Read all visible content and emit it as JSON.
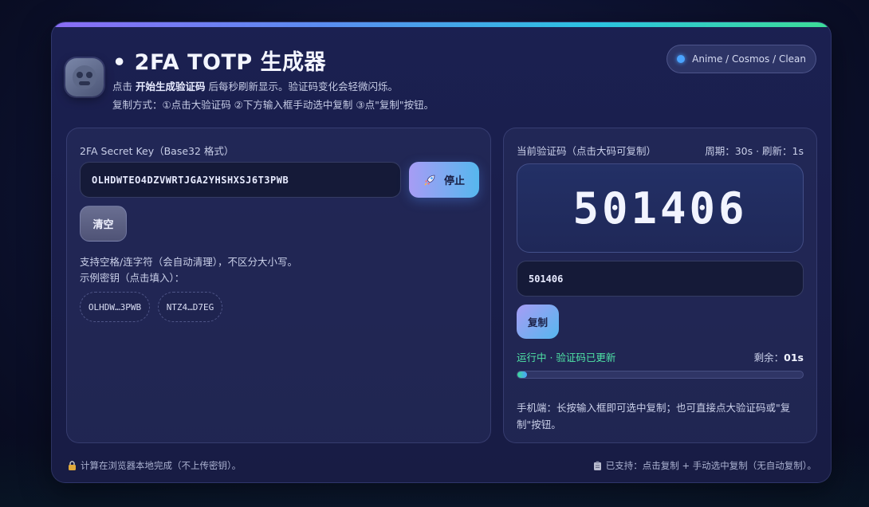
{
  "header": {
    "title": "• 2FA TOTP 生成器",
    "desc_line1_prefix": "点击",
    "desc_line1_bold": "开始生成验证码",
    "desc_line1_suffix": "后每秒刷新显示。验证码变化会轻微闪烁。",
    "desc_line2": "复制方式：①点击大验证码 ②下方输入框手动选中复制 ③点\"复制\"按钮。",
    "theme_label": "Anime / Cosmos / Clean"
  },
  "left_panel": {
    "secret_label": "2FA Secret Key（Base32 格式）",
    "secret_value": "OLHDWTEO4DZVWRTJGA2YHSHXSJ6T3PWB",
    "stop_button": "停止",
    "clear_button": "清空",
    "hint_line1": "支持空格/连字符（会自动清理），不区分大小写。",
    "hint_line2": "示例密钥（点击填入）：",
    "examples": [
      "OLHDW…3PWB",
      "NTZ4…D7EG"
    ]
  },
  "right_panel": {
    "code_label": "当前验证码（点击大码可复制）",
    "period_label": "周期：30s · 刷新：1s",
    "code": "501406",
    "code_input_value": "501406",
    "copy_button": "复制",
    "status_text": "运行中 · 验证码已更新",
    "remain_label": "剩余：",
    "remain_value": "01s",
    "progress": 0.033,
    "mobile_note": "手机端：长按输入框即可选中复制；也可直接点大验证码或\"复制\"按钮。"
  },
  "footer": {
    "left": "计算在浏览器本地完成（不上传密钥）。",
    "right": "已支持：点击复制 + 手动选中复制（无自动复制）。"
  },
  "colors": {
    "accent_green": "#4fe3a6",
    "accent_blue": "#4aa3ff",
    "accent_purple": "#a79cf5"
  },
  "icons": {
    "avatar": "robot-avatar-icon",
    "stop": "rocket-icon",
    "footer_left": "lock-icon",
    "footer_right": "clipboard-icon"
  }
}
